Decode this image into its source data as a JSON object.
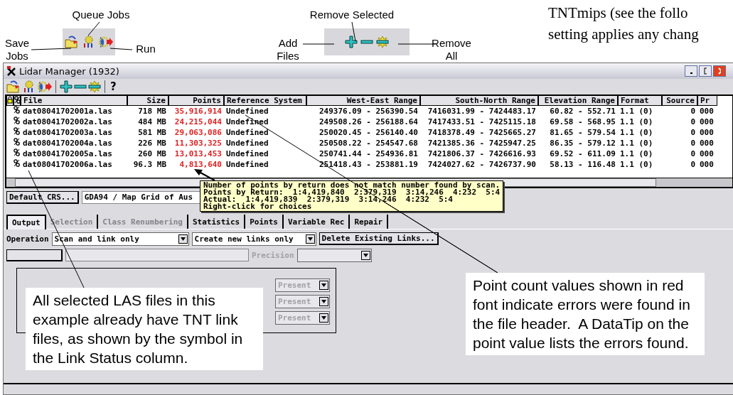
{
  "figure": {
    "labels": [
      {
        "text": "Queue Jobs"
      },
      {
        "text": "Save Jobs"
      },
      {
        "text": "Run"
      },
      {
        "text": "Remove Selected"
      },
      {
        "text": "Add Files"
      },
      {
        "text": "Remove All"
      }
    ]
  },
  "page_text": [
    "TNTmips (see the follo",
    "setting applies any chang"
  ],
  "window": {
    "title": "Lidar Manager (1932)",
    "toolbar": {
      "help": "?"
    },
    "table": {
      "columns": [
        "File",
        "Size",
        "Points",
        "Reference System",
        "West-East Range",
        "South-North Range",
        "Elevation Range",
        "Format",
        "Source",
        "Pr"
      ],
      "rows": [
        {
          "linked": true,
          "file": "dat08041702001a.las",
          "size": "718 MB",
          "points": "35,916,914",
          "points_error": true,
          "reference_system": "Undefined",
          "west_east": "249376.09 - 256390.54",
          "south_north": "7416031.99 - 7424483.17",
          "elevation": "60.82 - 552.71",
          "format": "1.1 (0)",
          "source": "0",
          "pr": "000"
        },
        {
          "linked": true,
          "file": "dat08041702002a.las",
          "size": "484 MB",
          "points": "24,215,044",
          "points_error": true,
          "reference_system": "Undefined",
          "west_east": "249508.26 - 256188.64",
          "south_north": "7417433.51 - 7425115.18",
          "elevation": "69.58 - 568.95",
          "format": "1.1 (0)",
          "source": "0",
          "pr": "000"
        },
        {
          "linked": true,
          "file": "dat08041702003a.las",
          "size": "581 MB",
          "points": "29,063,086",
          "points_error": true,
          "reference_system": "Undefined",
          "west_east": "250020.45 - 256140.40",
          "south_north": "7418378.49 - 7425665.27",
          "elevation": "81.65 - 579.54",
          "format": "1.1 (0)",
          "source": "0",
          "pr": "000"
        },
        {
          "linked": true,
          "file": "dat08041702004a.las",
          "size": "226 MB",
          "points": "11,303,325",
          "points_error": true,
          "reference_system": "Undefined",
          "west_east": "250508.22 - 254547.68",
          "south_north": "7421385.36 - 7425947.25",
          "elevation": "86.35 - 579.12",
          "format": "1.1 (0)",
          "source": "0",
          "pr": "000"
        },
        {
          "linked": true,
          "file": "dat08041702005a.las",
          "size": "260 MB",
          "points": "13,013,453",
          "points_error": true,
          "reference_system": "Undefined",
          "west_east": "250741.44 - 254936.81",
          "south_north": "7421806.37 - 7426616.93",
          "elevation": "69.52 - 611.09",
          "format": "1.1 (0)",
          "source": "0",
          "pr": "000"
        },
        {
          "linked": true,
          "file": "dat08041702006a.las",
          "size": "96.3 MB",
          "points": "4,813,640",
          "points_error": true,
          "reference_system": "Undefined",
          "west_east": "251418.43 - 253881.19",
          "south_north": "7424027.62 - 7426737.90",
          "elevation": "58.13 - 116.48",
          "format": "1.1 (0)",
          "source": "0",
          "pr": "000"
        }
      ]
    },
    "tooltip": {
      "lines": [
        "Number of points by return does not match number found by scan.",
        "Points by Return:  1:4,419,840  2:379,319  3:14,246  4:232  5:4",
        "Actual:  1:4,419,839  2:379,319  3:14,246  4:232  5:4",
        "Right-click for choices"
      ]
    },
    "crs": {
      "button": "Default CRS...",
      "value": "GDA94 / Map Grid of Aus"
    },
    "tabs": [
      {
        "label": "Output",
        "selected": true,
        "disabled": false
      },
      {
        "label": "Selection",
        "selected": false,
        "disabled": true
      },
      {
        "label": "Class Renumbering",
        "selected": false,
        "disabled": true
      },
      {
        "label": "Statistics",
        "selected": false,
        "disabled": false
      },
      {
        "label": "Points",
        "selected": false,
        "disabled": false
      },
      {
        "label": "Variable Rec",
        "selected": false,
        "disabled": false
      },
      {
        "label": "Repair",
        "selected": false,
        "disabled": false
      }
    ],
    "operation": {
      "label": "Operation",
      "mode": "Scan and link only",
      "links": "Create new links only",
      "delete_button": "Delete Existing Links..."
    },
    "precision": {
      "label": "Precision",
      "disabled": true
    },
    "present_dropdowns": [
      {
        "value": "Present",
        "disabled": true
      },
      {
        "value": "Present",
        "disabled": true
      },
      {
        "value": "Present",
        "disabled": true
      }
    ]
  },
  "callouts": [
    {
      "text": "All selected LAS files in this example already have TNT link files, as shown by the symbol in the Link Status column."
    },
    {
      "text": "Point count values shown in red font indicate errors were found in the file header.  A DataTip on the point value lists the errors found."
    }
  ]
}
